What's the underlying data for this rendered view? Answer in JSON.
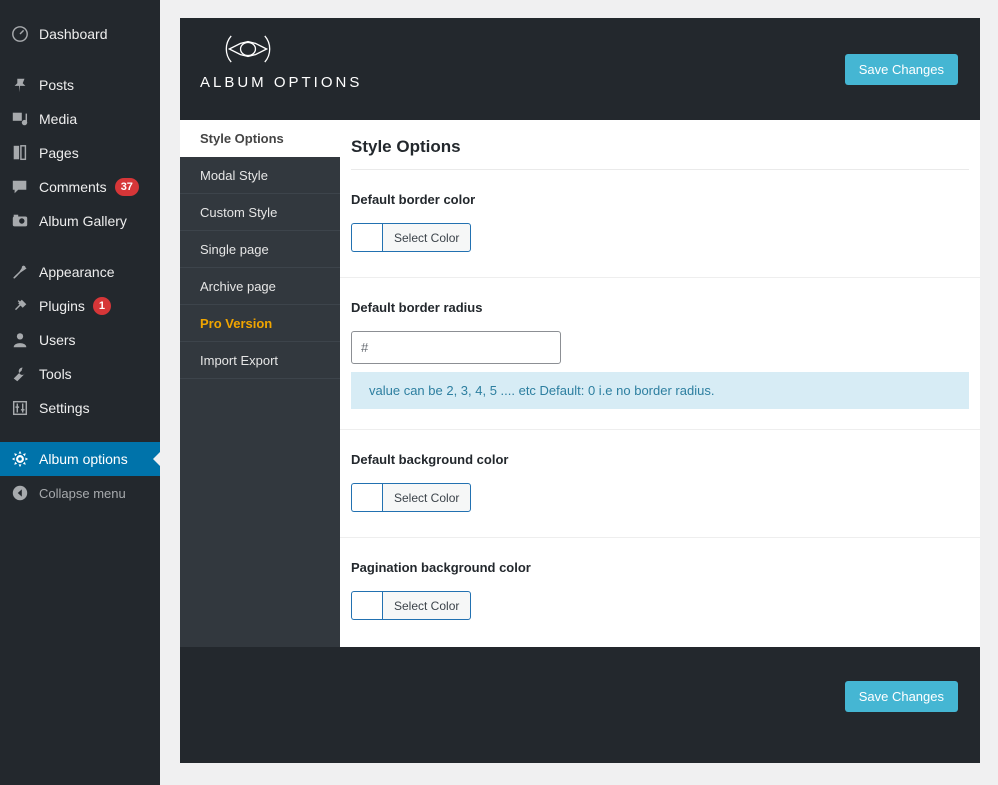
{
  "wp_sidebar": {
    "items": [
      {
        "label": "Dashboard",
        "icon": "dashboard-icon",
        "badge": null,
        "active": false,
        "gap_before": false
      },
      {
        "label": "Posts",
        "icon": "pin-icon",
        "badge": null,
        "active": false,
        "gap_before": true
      },
      {
        "label": "Media",
        "icon": "media-icon",
        "badge": null,
        "active": false,
        "gap_before": false
      },
      {
        "label": "Pages",
        "icon": "pages-icon",
        "badge": null,
        "active": false,
        "gap_before": false
      },
      {
        "label": "Comments",
        "icon": "comment-icon",
        "badge": "37",
        "active": false,
        "gap_before": false
      },
      {
        "label": "Album Gallery",
        "icon": "camera-icon",
        "badge": null,
        "active": false,
        "gap_before": false
      },
      {
        "label": "Appearance",
        "icon": "brush-icon",
        "badge": null,
        "active": false,
        "gap_before": true
      },
      {
        "label": "Plugins",
        "icon": "plug-icon",
        "badge": "1",
        "active": false,
        "gap_before": false
      },
      {
        "label": "Users",
        "icon": "user-icon",
        "badge": null,
        "active": false,
        "gap_before": false
      },
      {
        "label": "Tools",
        "icon": "wrench-icon",
        "badge": null,
        "active": false,
        "gap_before": false
      },
      {
        "label": "Settings",
        "icon": "sliders-icon",
        "badge": null,
        "active": false,
        "gap_before": false
      },
      {
        "label": "Album options",
        "icon": "gear-icon",
        "badge": null,
        "active": true,
        "gap_before": true
      },
      {
        "label": "Collapse menu",
        "icon": "collapse-icon",
        "badge": null,
        "active": false,
        "gap_before": false
      }
    ],
    "active_color": "#0073aa",
    "badge_color": "#d63638"
  },
  "panel": {
    "brand_title": "ALBUM OPTIONS",
    "brand_logo_icon": "eye-lens-icon",
    "save_label": "Save Changes",
    "save_label_footer": "Save Changes",
    "accent_color": "#45b6d3"
  },
  "tabs": [
    {
      "label": "Style Options",
      "active": true,
      "pro": false
    },
    {
      "label": "Modal Style",
      "active": false,
      "pro": false
    },
    {
      "label": "Custom Style",
      "active": false,
      "pro": false
    },
    {
      "label": "Single page",
      "active": false,
      "pro": false
    },
    {
      "label": "Archive page",
      "active": false,
      "pro": false
    },
    {
      "label": "Pro Version",
      "active": false,
      "pro": true
    },
    {
      "label": "Import Export",
      "active": false,
      "pro": false
    }
  ],
  "content": {
    "title": "Style Options",
    "fields": [
      {
        "label": "Default border color",
        "type": "color",
        "button_label": "Select Color",
        "swatch_color": "#ffffff"
      },
      {
        "label": "Default border radius",
        "type": "text",
        "value": "",
        "placeholder": "#",
        "hint": "value can be 2, 3, 4, 5 .... etc Default: 0 i.e no border radius."
      },
      {
        "label": "Default background color",
        "type": "color",
        "button_label": "Select Color",
        "swatch_color": "#ffffff"
      },
      {
        "label": "Pagination background color",
        "type": "color",
        "button_label": "Select Color",
        "swatch_color": "#ffffff"
      }
    ]
  }
}
